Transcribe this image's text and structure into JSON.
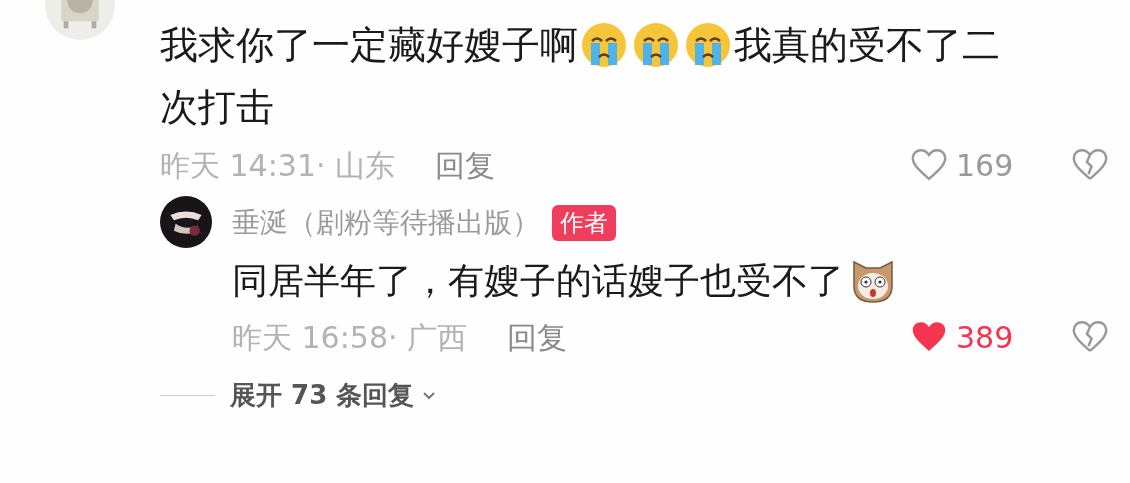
{
  "comments": [
    {
      "avatar": {
        "kind": "picture"
      },
      "lines": [
        [
          {
            "kind": "text",
            "text": "我求你了一定藏好嫂子啊"
          },
          {
            "kind": "crying-emoji"
          },
          {
            "kind": "crying-emoji"
          },
          {
            "kind": "crying-emoji"
          },
          {
            "kind": "text",
            "text": "我真的受不了二"
          }
        ],
        [
          {
            "kind": "text",
            "text": "次打击"
          }
        ]
      ],
      "time": "昨天 14:31· 山东",
      "reply": "回复",
      "likes": "169",
      "liked": false,
      "replies": [
        {
          "avatar": {
            "kind": "picture"
          },
          "name": "垂涎（剧粉等待播出版）",
          "badge": "作者",
          "lines": [
            [
              {
                "kind": "text",
                "text": "同居半年了，有嫂子的话嫂子也受不了"
              },
              {
                "kind": "dog-emoji"
              }
            ]
          ],
          "time": "昨天 16:58· 广西",
          "reply": "回复",
          "likes": "389",
          "liked": true
        }
      ],
      "expand": "展开 73 条回复"
    }
  ]
}
